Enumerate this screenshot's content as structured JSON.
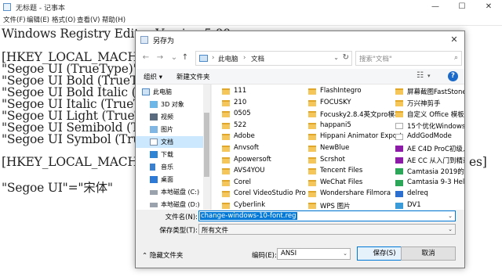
{
  "notepad": {
    "title": "无标题 - 记事本",
    "menu": [
      "文件(F)",
      "编辑(E)",
      "格式(O)",
      "查看(V)",
      "帮助(H)"
    ],
    "window_controls": {
      "minimize": "—",
      "maximize": "☐",
      "close": "✕"
    },
    "lines": [
      "Windows Registry Editor Version 5.00",
      "[HKEY_LOCAL_MACHINE\\SOF",
      "\"Segoe UI (TrueType)\"=\"",
      "\"Segoe UI Bold (TrueTyp",
      "\"Segoe UI Bold Italic (",
      "\"Segoe UI Italic (TrueT",
      "\"Segoe UI Light (TrueTy",
      "\"Segoe UI Semibold (Tru",
      "\"Segoe UI Symbol (TrueT",
      "[HKEY_LOCAL_MACHINE\\SOF",
      "\"Segoe UI\"=\"宋体\""
    ],
    "partial_right_1": "es]"
  },
  "dialog": {
    "title": "另存为",
    "close": "✕",
    "nav": {
      "back": "←",
      "forward": "→",
      "down": "⌄",
      "up": "↑"
    },
    "address": {
      "part1": "此电脑",
      "sep": "›",
      "part2": "文档",
      "dropdown": "⌄",
      "refresh": "↻"
    },
    "search_placeholder": "搜索\"文档\"",
    "search_icon": "⌕",
    "toolbar": {
      "organize": "组织 ▾",
      "new_folder": "新建文件夹",
      "view_icon": "☷",
      "help": "?"
    },
    "sidebar": [
      {
        "label": "此电脑",
        "icon": "computer-icon",
        "type": "pc"
      },
      {
        "label": "3D 对象",
        "icon": "cube-icon"
      },
      {
        "label": "视频",
        "icon": "video-icon"
      },
      {
        "label": "图片",
        "icon": "picture-icon"
      },
      {
        "label": "文档",
        "icon": "document-icon",
        "selected": true
      },
      {
        "label": "下载",
        "icon": "download-icon"
      },
      {
        "label": "音乐",
        "icon": "music-icon"
      },
      {
        "label": "桌面",
        "icon": "desktop-icon"
      },
      {
        "label": "本地磁盘 (C:)",
        "icon": "drive-icon"
      },
      {
        "label": "本地磁盘 (D:)",
        "icon": "drive-icon"
      }
    ],
    "files": {
      "col1": [
        "111",
        "210",
        "0505",
        "522",
        "Adobe",
        "Anvsoft",
        "Apowersoft",
        "AVS4YOU",
        "Corel",
        "Corel VideoStudio Pro",
        "Cyberlink"
      ],
      "col2": [
        "FlashIntegro",
        "FOCUSKY",
        "Focusky2.8.4英文pro模板",
        "happani5",
        "Hippani Animator Export",
        "NewBlue",
        "Scrshot",
        "Tencent Files",
        "WeChat Files",
        "Wondershare Filmora",
        "WPS 图片"
      ],
      "col3": [
        "屏幕截图FastStone C",
        "万兴神剪手",
        "自定义 Office 模板",
        "15个优化Windows 1",
        "AddGodMode",
        "AE C4D ProC初级入",
        "AE CC 从入门到精通",
        "Camtasia 2019的主",
        "Camtasia 9-3 Help",
        "delreq",
        "DV1"
      ],
      "col3_icons": [
        "folder",
        "folder",
        "folder",
        "shortcut",
        "shortcut",
        "adobe",
        "adobe",
        "cam",
        "cam",
        "del",
        "dv"
      ]
    },
    "filename_label": "文件名(N):",
    "filename_value": "change-windows-10-font.reg",
    "filetype_label": "保存类型(T):",
    "filetype_value": "所有文件",
    "dropdown_arrow": "⌄",
    "hide_folders": "⌃ 隐藏文件夹",
    "encoding_label": "编码(E):",
    "encoding_value": "ANSI",
    "save_button": "保存(S)",
    "cancel_button": "取消"
  }
}
